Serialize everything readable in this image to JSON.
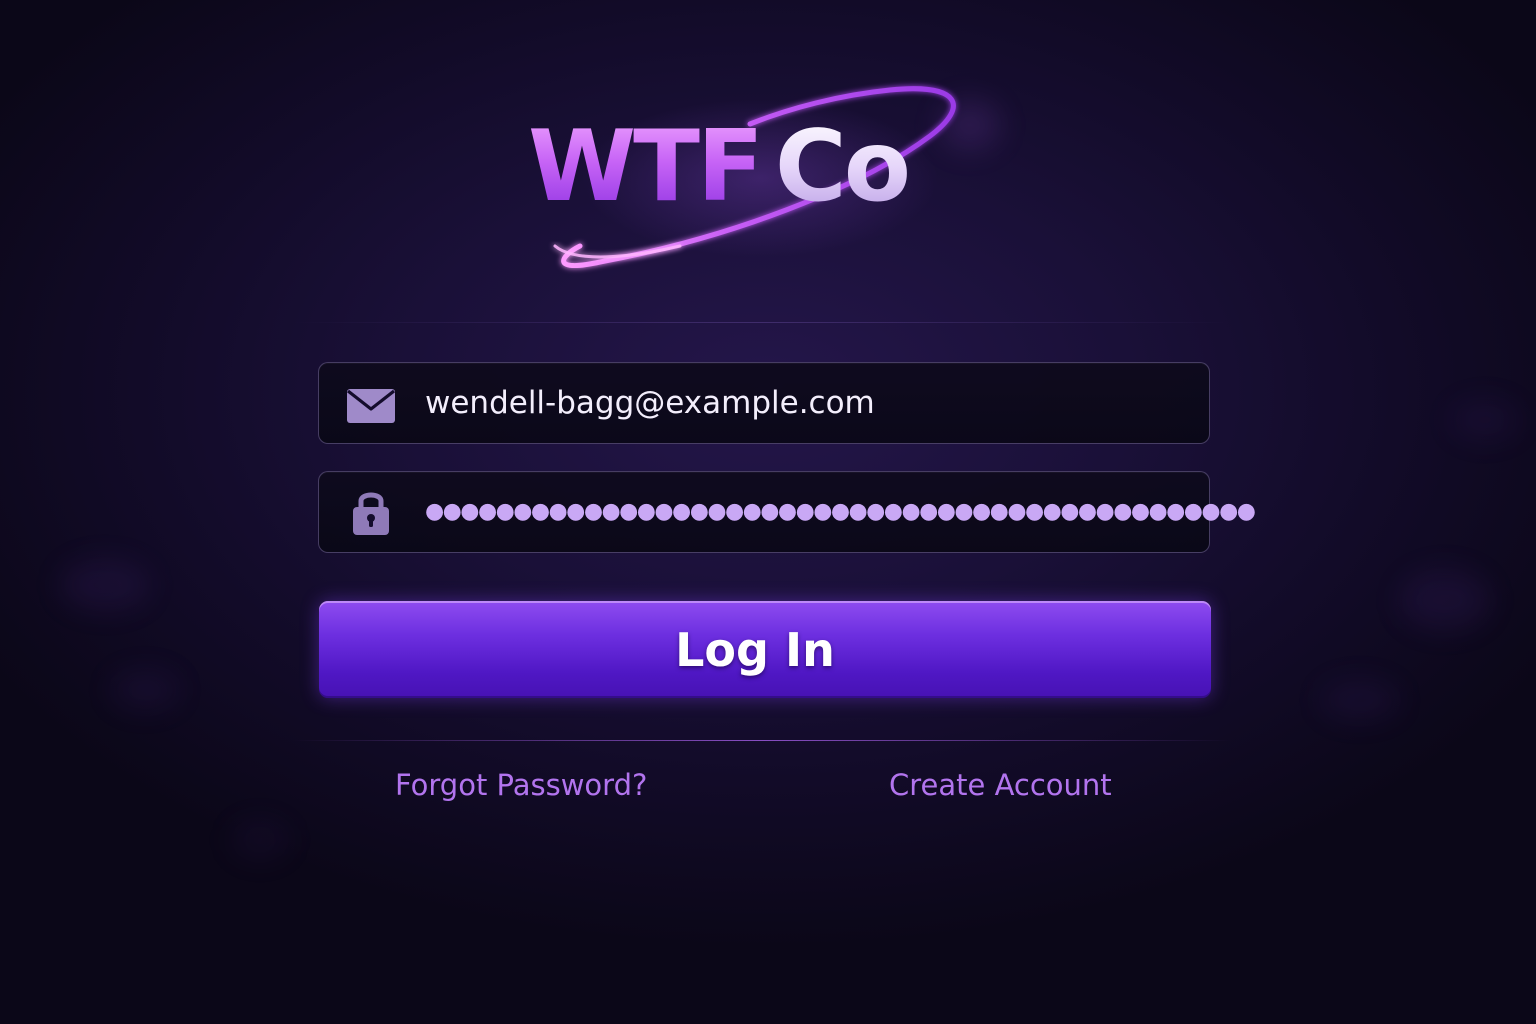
{
  "brand": {
    "logo_part1": "WTF",
    "logo_part2": "Co"
  },
  "login_form": {
    "email": {
      "icon": "envelope-icon",
      "value": "wendell-bagg@example.com"
    },
    "password": {
      "icon": "lock-icon",
      "masked_value": "●●●●●●●●●●●●●●●●●●●●●●●●●●●●●●●●●●●●●●●●●●●●●●●"
    },
    "submit_label": "Log In"
  },
  "links": {
    "forgot_password": "Forgot Password?",
    "create_account": "Create Account"
  },
  "colors": {
    "background": "#140c2c",
    "accent": "#6d2fe0",
    "link": "#b274ee",
    "icon": "#9f8ac9"
  }
}
